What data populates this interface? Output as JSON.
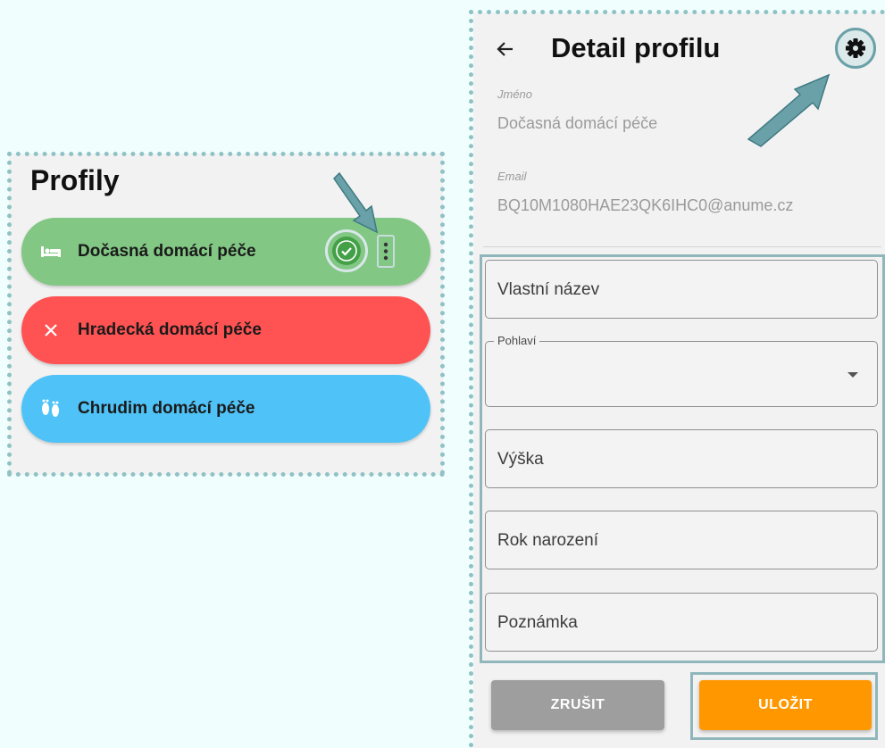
{
  "profiles_panel": {
    "title": "Profily",
    "items": [
      {
        "label": "Dočasná domácí péče",
        "icon": "bed-icon",
        "color": "#82c784",
        "status": "check-icon"
      },
      {
        "label": "Hradecká domácí péče",
        "icon": "close-icon",
        "color": "#ff5252"
      },
      {
        "label": "Chrudim domácí péče",
        "icon": "footprints-icon",
        "color": "#4fc3f7"
      }
    ]
  },
  "detail": {
    "title": "Detail profilu",
    "name_label": "Jméno",
    "name_value": "Dočasná domácí péče",
    "email_label": "Email",
    "email_value": "BQ10M1080HAE23QK6IHC0@anume.cz",
    "custom_name_placeholder": "Vlastní název",
    "gender_label": "Pohlaví",
    "gender_value": "",
    "height_placeholder": "Výška",
    "birth_year_placeholder": "Rok narození",
    "note_placeholder": "Poznámka",
    "cancel_label": "ZRUŠIT",
    "save_label": "ULOŽIT"
  },
  "colors": {
    "background": "#f0fffe",
    "highlight": "#8fc2c6",
    "cancel_button": "#9e9e9e",
    "save_button": "#ff9800",
    "check_badge": "#43a047"
  }
}
